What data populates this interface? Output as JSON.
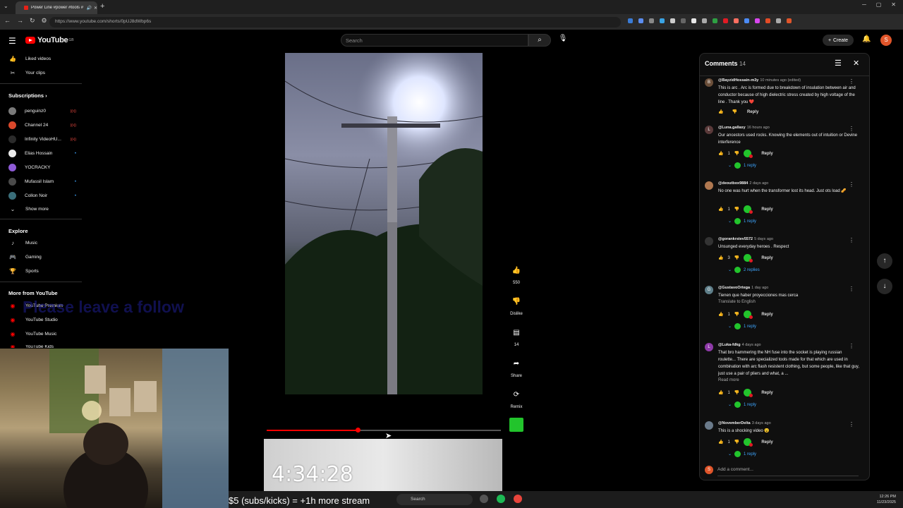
{
  "browser": {
    "tab_title": "Power Line #power #tools #",
    "url": "https://www.youtube.com/shorts/0pUJ8dWbp6s",
    "ext_colors": [
      "#3a7bd5",
      "#5b8def",
      "#888888",
      "#3aa3e3",
      "#cccccc",
      "#666666",
      "#e8e8e8",
      "#aaaaaa",
      "#2ea043",
      "#e01b24",
      "#ff6f61",
      "#4c8bf5",
      "#d946ef",
      "#e34c26",
      "#aaaaaa",
      "#e0552a"
    ]
  },
  "header": {
    "logo_text": "YouTube",
    "logo_sup": "GB",
    "search_placeholder": "Search",
    "create_label": "Create",
    "avatar_letter": "S"
  },
  "sidebar": {
    "top": [
      {
        "label": "Liked videos",
        "icon": "thumb-up-icon"
      },
      {
        "label": "Your clips",
        "icon": "scissors-icon"
      }
    ],
    "subscriptions_heading": "Subscriptions",
    "subscriptions": [
      {
        "label": "penguinz0",
        "color": "#7a7a7a",
        "badge": "live"
      },
      {
        "label": "Channel 24",
        "color": "#d9482b",
        "badge": "live"
      },
      {
        "label": "Infinity VideoHU...",
        "color": "#2b2b2b",
        "badge": "live"
      },
      {
        "label": "Elias Hossain",
        "color": "#eaeaea",
        "badge": "dot"
      },
      {
        "label": "YOCRACKY",
        "color": "#8e5bd6",
        "badge": ""
      },
      {
        "label": "Mufassil Islam",
        "color": "#4a4a4a",
        "badge": "dot"
      },
      {
        "label": "Collon Noir",
        "color": "#3a6e7a",
        "badge": "dot"
      }
    ],
    "show_more": "Show more",
    "explore_heading": "Explore",
    "explore": [
      {
        "label": "Music",
        "icon": "music-note-icon"
      },
      {
        "label": "Gaming",
        "icon": "gamepad-icon"
      },
      {
        "label": "Sports",
        "icon": "trophy-icon"
      }
    ],
    "more_heading": "More from YouTube",
    "more": [
      {
        "label": "YouTube Premium"
      },
      {
        "label": "YouTube Studio"
      },
      {
        "label": "YouTube Music"
      },
      {
        "label": "YouTube Kids"
      }
    ]
  },
  "player": {
    "progress": 0.39
  },
  "actions": {
    "likes": "550",
    "dislike_label": "Dislike",
    "comments": "14",
    "share_label": "Share",
    "remix_label": "Remix"
  },
  "stream": {
    "clock": "4:34:28",
    "ticker": "$5 (subs/kicks) = +1h more stream",
    "watermark": "Please leave a follow"
  },
  "taskbar": {
    "search": "Search",
    "time": "12:26 PM",
    "date": "11/23/2025",
    "icon_colors": [
      "#555555",
      "#1db954",
      "#e8453c"
    ]
  },
  "comments": {
    "title": "Comments",
    "count": "14",
    "add_placeholder": "Add a comment...",
    "add_avatar": "S",
    "reply_label": "Reply",
    "items": [
      {
        "user": "@BayzidHossain-m3y",
        "when": "10 minutes ago (edited)",
        "avatar": "B",
        "avatar_color": "#6b4f3a",
        "text": "This is arc . Arc is formed due to breakdown of insulation between air and conductor because of high dielectric stress created by high voltage of the line . Thank you ❤️",
        "likes": "",
        "heart": false,
        "replies": "",
        "link": ""
      },
      {
        "user": "@Luna.gallaxy",
        "when": "16 hours ago",
        "avatar": "L",
        "avatar_color": "#5a3a3a",
        "text": "Our ancestors used rocks. Knowing the elements out of intuition or Devine interference",
        "likes": "1",
        "heart": true,
        "replies": "1 reply",
        "link": ""
      },
      {
        "user": "@deoutbox9884",
        "when": "2 days ago",
        "avatar": "",
        "avatar_color": "#b07850",
        "text": "No one was hurt when the transformer lost its head. Just ots load 🥜",
        "likes": "1",
        "heart": true,
        "replies": "1 reply",
        "link": ""
      },
      {
        "user": "@gorankrstev5572",
        "when": "5 days ago",
        "avatar": "",
        "avatar_color": "#333333",
        "text": "Unsunged everyday heroes . Respect",
        "likes": "3",
        "heart": true,
        "replies": "2 replies",
        "link": ""
      },
      {
        "user": "@GustavoOrtega",
        "when": "1 day ago",
        "avatar": "G",
        "avatar_color": "#5f7f8a",
        "text": "Tienen que haber proyecciones mas cerca",
        "likes": "1",
        "heart": true,
        "replies": "1 reply",
        "link": "Translate to English"
      },
      {
        "user": "@Luka-fdkg",
        "when": "4 days ago",
        "avatar": "L",
        "avatar_color": "#8e3aa8",
        "text": "That bro hammering the NH fuse into the socket is playing russian roulette... There are specialized tools made for that which are used in combination with arc flash resistent clothing, but some people, like that guy, just use a pair of pliers and what, a ...",
        "likes": "1",
        "heart": true,
        "replies": "1 reply",
        "link": "Read more"
      },
      {
        "user": "@NovemberDelta",
        "when": "3 days ago",
        "avatar": "",
        "avatar_color": "#6a7a8a",
        "text": "This is a shocking video 😮",
        "likes": "1",
        "heart": true,
        "replies": "1 reply",
        "link": ""
      }
    ]
  }
}
